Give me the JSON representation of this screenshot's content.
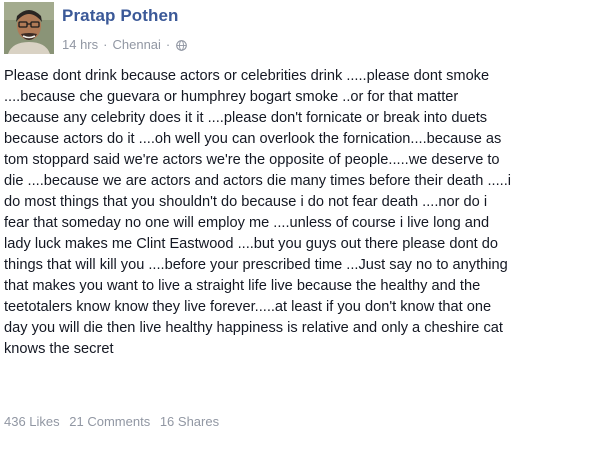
{
  "post": {
    "author": "Pratap Pothen",
    "time": "14 hrs",
    "location": "Chennai",
    "dot": "·",
    "audience_icon": "globe-icon",
    "lines": [
      "Please dont drink because actors or celebrities drink .....please dont smoke",
      "....because che guevara or humphrey bogart smoke ..or for that matter",
      "because any celebrity does it it ....please don't fornicate or break into duets",
      "because actors do it ....oh well you can overlook the fornication....because as",
      "tom stoppard said we're actors we're the opposite of people.....we deserve to",
      "die ....because we are actors and actors die many times before their death .....i",
      "do most things that you shouldn't do because i do not fear death ....nor do i",
      "fear that someday no one will employ me ....unless of course i live long and",
      "lady luck makes me Clint Eastwood ....but you guys out there please dont do",
      "things that will kill you ....before your prescribed time ...Just say no to anything",
      "that makes you want to live a straight life live because the healthy and the",
      "teetotalers know know they live forever.....at least if you don't know that one",
      "day you will die then live healthy happiness is relative and only a cheshire cat",
      "knows the secret"
    ]
  },
  "stats": {
    "likes": "436 Likes",
    "comments": "21 Comments",
    "shares": "16 Shares"
  },
  "colors": {
    "author_link": "#3b5998",
    "meta_gray": "#9197a3",
    "text": "#141823"
  }
}
